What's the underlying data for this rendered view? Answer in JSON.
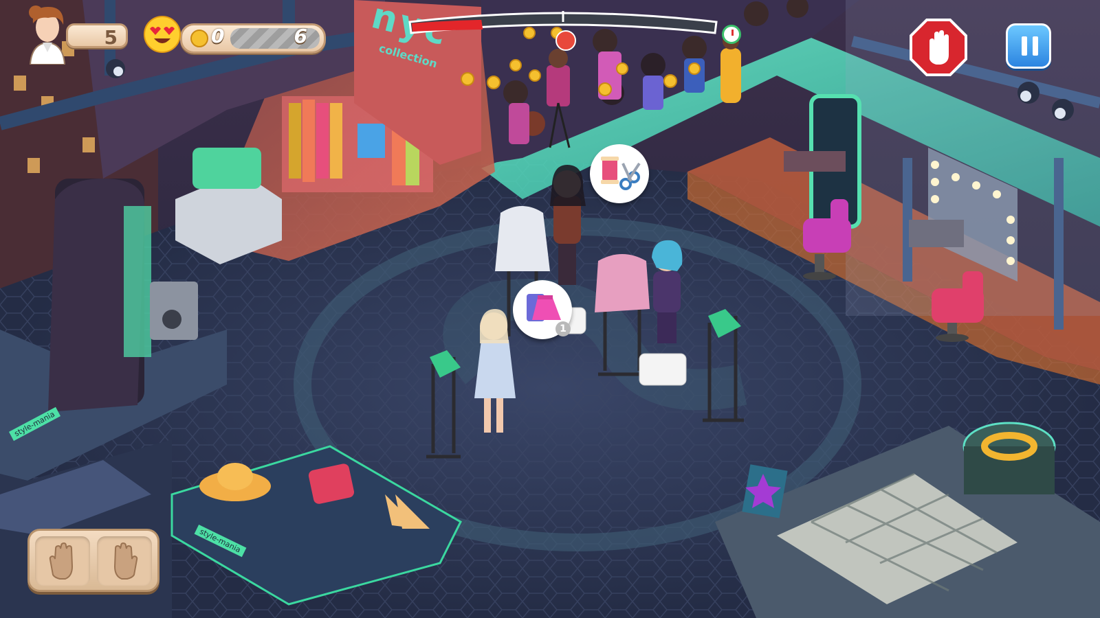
{
  "hud": {
    "level": "5",
    "coins_current": "0",
    "coins_target": "6",
    "mood_icon": "heart-eyes-emoji-icon",
    "crowd_progress": 0.23
  },
  "scene": {
    "store_sign_line1": "nyc",
    "store_sign_line2": "collection",
    "tape_text": "style-mania"
  },
  "bubbles": [
    {
      "icon": "tailoring-icon"
    },
    {
      "icon": "skirt-icon",
      "count": "1"
    }
  ],
  "colors": {
    "floor": "#2b3552",
    "accent_teal": "#57e3c7",
    "stop_red": "#d8262e",
    "pause_blue": "#2c84e0",
    "progress_red": "#e3262a"
  }
}
